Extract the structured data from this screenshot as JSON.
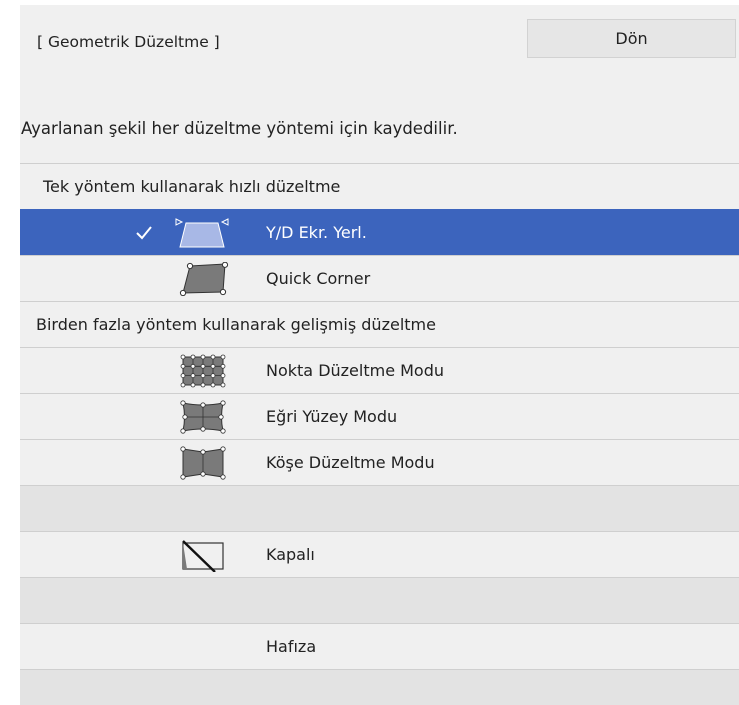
{
  "header": {
    "title": "[ Geometrik Düzeltme ]",
    "back_label": "Dön"
  },
  "info_text": "Ayarlanan şekil her düzeltme yöntemi için kaydedilir.",
  "sections": {
    "single": "Tek yöntem kullanarak hızlı düzeltme",
    "multi": "Birden fazla yöntem kullanarak gelişmiş düzeltme"
  },
  "items": {
    "hv_keystone": {
      "label": "Y/D Ekr. Yerl.",
      "icon": "hv-keystone-icon",
      "selected": true
    },
    "quick_corner": {
      "label": "Quick Corner",
      "icon": "quick-corner-icon"
    },
    "point_correction": {
      "label": "Nokta Düzeltme Modu",
      "icon": "point-grid-icon"
    },
    "curved_surface": {
      "label": "Eğri Yüzey Modu",
      "icon": "curved-surface-icon"
    },
    "corner_wall": {
      "label": "Köşe Düzeltme Modu",
      "icon": "corner-wall-icon"
    },
    "off": {
      "label": "Kapalı",
      "icon": "off-icon"
    },
    "memory": {
      "label": "Hafıza"
    }
  },
  "colors": {
    "selected_row": "#3c64bd",
    "panel_bg": "#f0f0f0",
    "blank_row": "#e3e3e3"
  }
}
